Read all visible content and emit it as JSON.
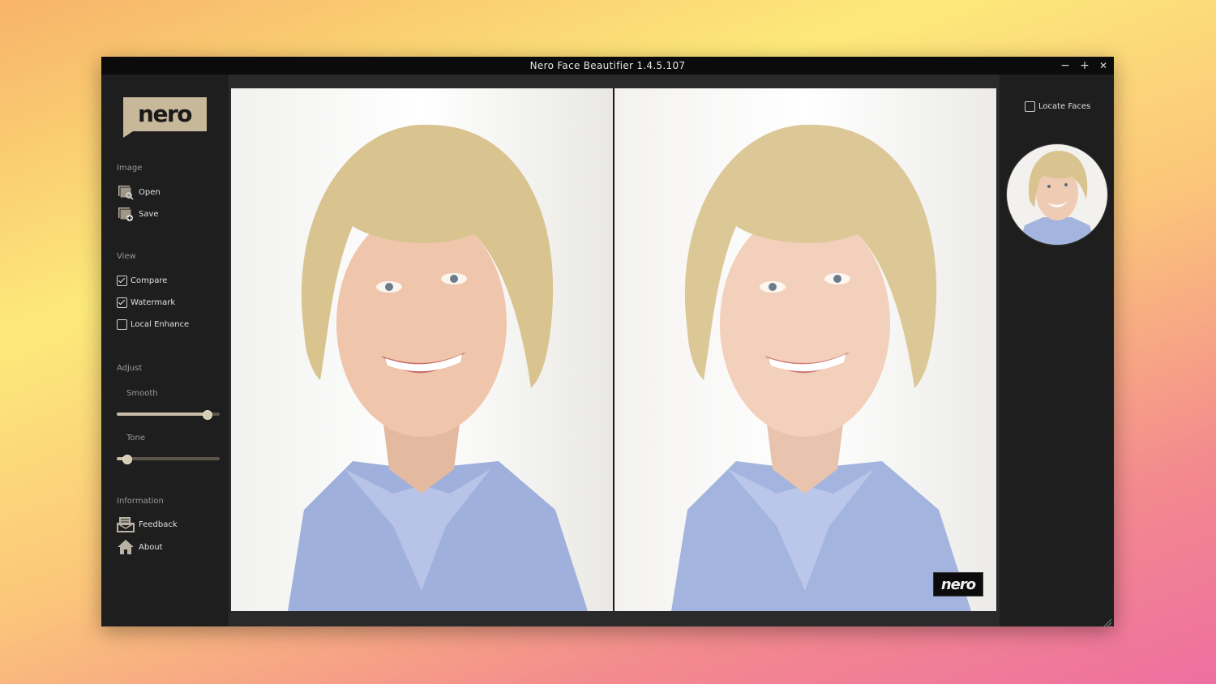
{
  "window": {
    "title": "Nero Face Beautifier 1.4.5.107",
    "controls": {
      "minimize": "−",
      "maximize": "+",
      "close": "✕"
    }
  },
  "logo": {
    "text": "nero"
  },
  "sidebar": {
    "image_section": "Image",
    "open_label": "Open",
    "save_label": "Save",
    "view_section": "View",
    "view_options": [
      {
        "label": "Compare",
        "checked": true
      },
      {
        "label": "Watermark",
        "checked": true
      },
      {
        "label": "Local Enhance",
        "checked": false
      }
    ],
    "adjust_section": "Adjust",
    "smooth_label": "Smooth",
    "smooth_value": 0.88,
    "tone_label": "Tone",
    "tone_value": 0.1,
    "information_section": "Information",
    "feedback_label": "Feedback",
    "about_label": "About"
  },
  "right_panel": {
    "locate_faces_label": "Locate Faces",
    "locate_faces_checked": false
  },
  "watermark": {
    "text": "nero"
  },
  "colors": {
    "accent": "#c8bca6",
    "logo_bg": "#c8b89a",
    "icon": "#b9b1a3"
  }
}
